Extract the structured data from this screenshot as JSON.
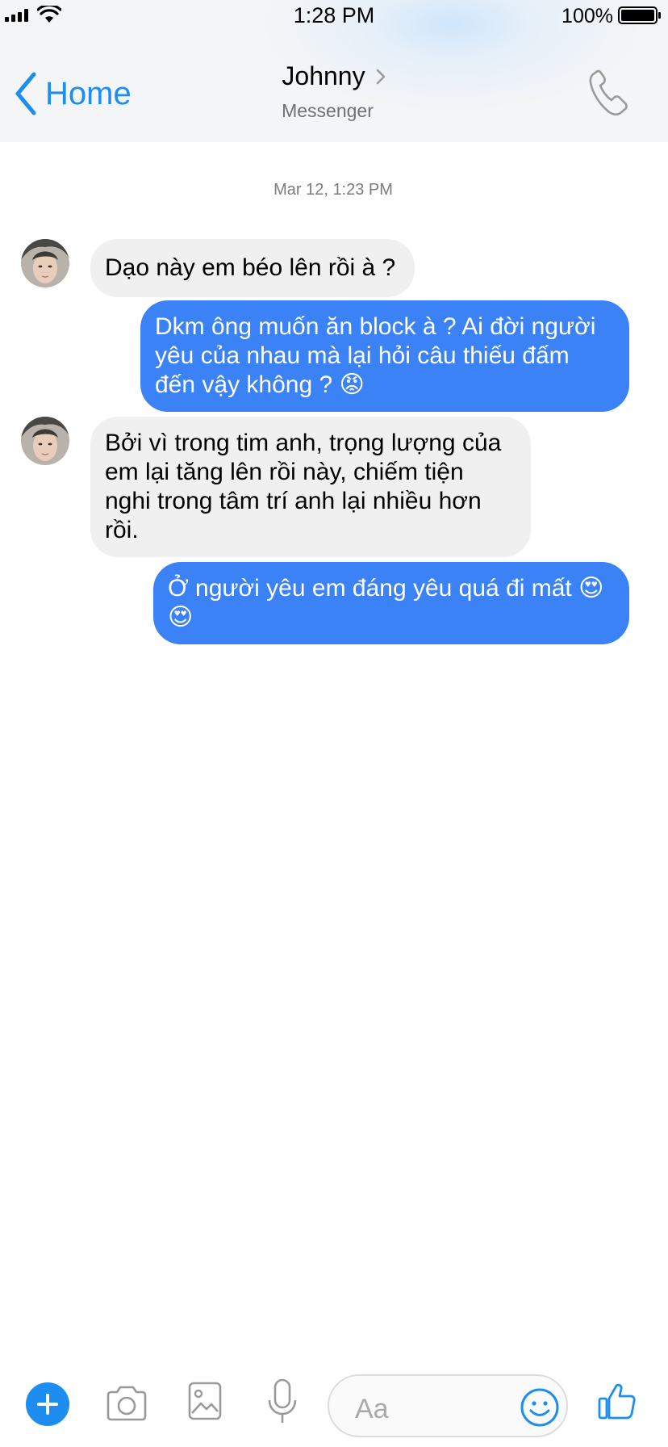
{
  "status": {
    "time": "1:28 PM",
    "battery": "100%"
  },
  "header": {
    "back_label": "Home",
    "contact_name": "Johnny",
    "subtitle": "Messenger",
    "call_icon": "phone-icon"
  },
  "conversation": {
    "timestamp": "Mar 12, 1:23 PM",
    "messages": [
      {
        "direction": "incoming",
        "lines": [
          "Dạo này em béo lên rồi à ?"
        ]
      },
      {
        "direction": "outgoing",
        "lines": [
          "Dkm ông muốn ăn block à ? Ai đời người",
          "yêu của nhau mà lại hỏi câu thiếu đấm",
          "đến vậy không ? 😡"
        ]
      },
      {
        "direction": "incoming",
        "lines": [
          "Bởi vì trong tim anh, trọng lượng của",
          "em lại tăng lên rồi này, chiếm tiện",
          "nghi trong tâm trí anh lại nhiều hơn",
          "rồi."
        ]
      },
      {
        "direction": "outgoing",
        "lines": [
          "Ở người yêu em đáng yêu quá đi mất 😍",
          "😍"
        ]
      }
    ]
  },
  "composer": {
    "placeholder": "Aa",
    "icons": [
      "plus-icon",
      "camera-icon",
      "image-icon",
      "microphone-icon",
      "smiley-icon",
      "thumbs-up-icon"
    ],
    "accent": "#1d8ef0",
    "bubble_out_color": "#3b82f6",
    "bubble_in_color": "#f0f0f0"
  }
}
